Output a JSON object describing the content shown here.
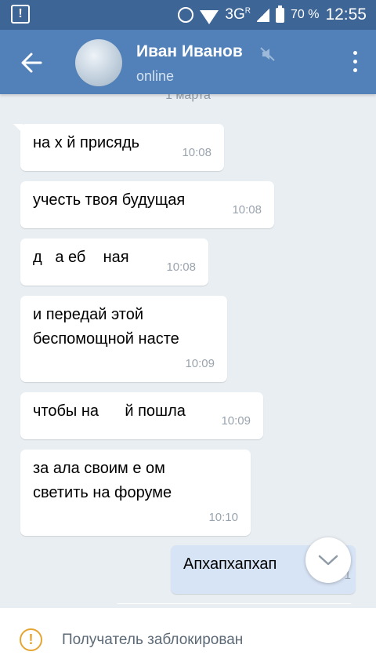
{
  "status_bar": {
    "network": "3G",
    "network_sup": "R",
    "battery": "70 %",
    "time": "12:55",
    "icons": [
      "alert-icon",
      "alarm-icon",
      "wifi-icon",
      "signal-icon",
      "battery-icon"
    ]
  },
  "header": {
    "name": "Иван Иванов",
    "status": "online",
    "icons": [
      "back-arrow-icon",
      "mute-icon",
      "more-vertical-icon"
    ]
  },
  "chat": {
    "date_separator": "1 марта",
    "messages": [
      {
        "text": "на х  й присядь",
        "time": "10:08",
        "direction": "incoming"
      },
      {
        "text": "учесть твоя будущая",
        "time": "10:08",
        "direction": "incoming"
      },
      {
        "text": "д   а еб    ная",
        "time": "10:08",
        "direction": "incoming"
      },
      {
        "text": "и передай этой\nбеспомощной насте",
        "time": "10:09",
        "direction": "incoming"
      },
      {
        "text": "чтобы на      й пошла",
        "time": "10:09",
        "direction": "incoming"
      },
      {
        "text": "за      ала своим е       ом\nсветить на форуме",
        "time": "10:10",
        "direction": "incoming"
      },
      {
        "text": "Апхапхапхап",
        "time": "1",
        "direction": "outgoing"
      }
    ]
  },
  "footer": {
    "text": "Получатель заблокирован",
    "icon": "warning-icon"
  },
  "colors": {
    "status_bar": "#3d6596",
    "header": "#5181b8",
    "background": "#e9eef3",
    "incoming_bubble": "#ffffff",
    "outgoing_bubble": "#d7e4f5",
    "warning": "#e6a532"
  }
}
